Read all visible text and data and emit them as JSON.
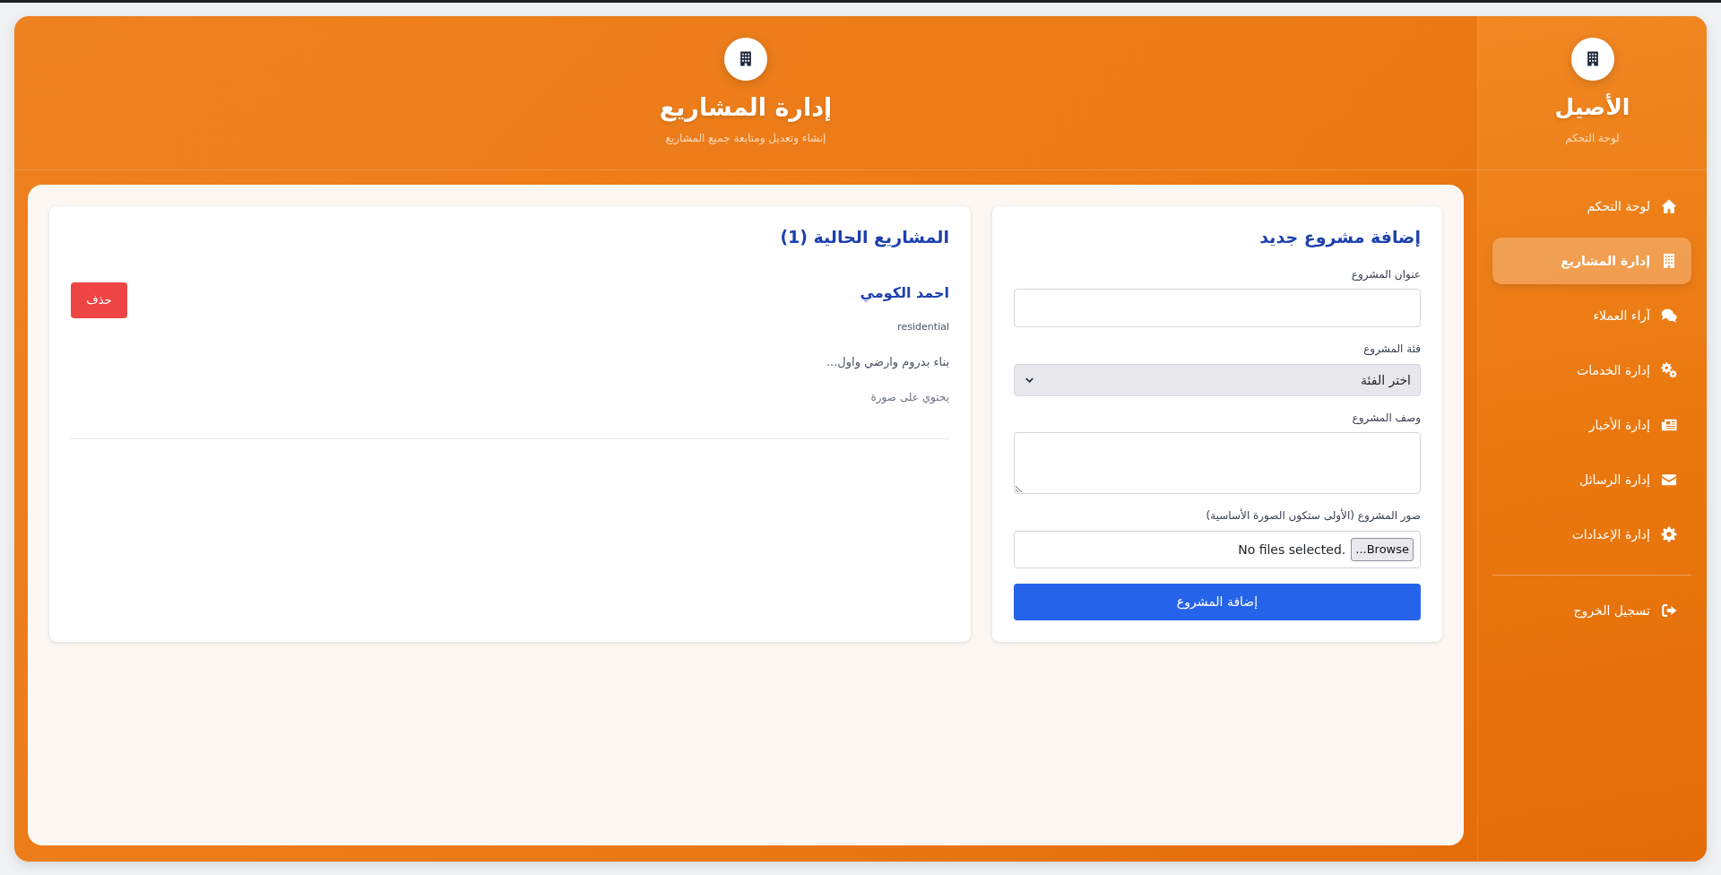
{
  "sidebar": {
    "brand": "الأصيل",
    "subtitle": "لوحة التحكم",
    "items": [
      {
        "label": "لوحة التحكم",
        "selected": false
      },
      {
        "label": "إدارة المشاريع",
        "selected": true
      },
      {
        "label": "آراء العملاء",
        "selected": false
      },
      {
        "label": "إدارة الخدمات",
        "selected": false
      },
      {
        "label": "إدارة الأخبار",
        "selected": false
      },
      {
        "label": "إدارة الرسائل",
        "selected": false
      },
      {
        "label": "إدارة الإعدادات",
        "selected": false
      }
    ],
    "logout": {
      "label": "تسجيل الخروج"
    }
  },
  "header": {
    "title": "إدارة المشاريع",
    "subtitle": "إنشاء وتعديل ومتابعة جميع المشاريع"
  },
  "form": {
    "title": "إضافة مشروع جديد",
    "fields": [
      {
        "kind": "text",
        "label": "عنوان المشروع"
      },
      {
        "kind": "select",
        "label": "فئة المشروع",
        "value": "اختر الفئة"
      },
      {
        "kind": "textarea",
        "label": "وصف المشروع"
      },
      {
        "kind": "file",
        "label": "صور المشروع (الأولى ستكون الصورة الأساسية)",
        "button": "...Browse",
        "value": "No files selected."
      }
    ],
    "submit": "إضافة المشروع"
  },
  "projects": {
    "title": "المشاريع الحالية (1)",
    "items": [
      {
        "name": "احمد الكومي",
        "category": "residential",
        "description": "بناء بدروم وارضي واول...",
        "image_note": "يحتوي على صورة",
        "delete": "حذف"
      }
    ]
  }
}
